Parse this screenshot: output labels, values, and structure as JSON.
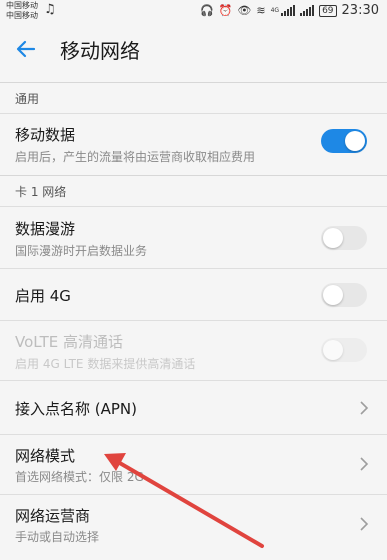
{
  "status_bar": {
    "carrier1": "中国移动",
    "carrier2": "中国移动",
    "network_type": "4G",
    "battery": "69",
    "time": "23:30"
  },
  "header": {
    "title": "移动网络"
  },
  "sections": {
    "general": "通用",
    "sim1": "卡 1 网络"
  },
  "mobile_data": {
    "label": "移动数据",
    "desc": "启用后，产生的流量将由运营商收取相应费用",
    "on": true
  },
  "roaming": {
    "label": "数据漫游",
    "desc": "国际漫游时开启数据业务",
    "on": false
  },
  "enable_4g": {
    "label": "启用 4G",
    "on": false
  },
  "volte": {
    "label": "VoLTE 高清通话",
    "desc": "启用 4G LTE 数据来提供高清通话",
    "on": false
  },
  "apn": {
    "label": "接入点名称 (APN)"
  },
  "network_mode": {
    "label": "网络模式",
    "desc": "首选网络模式：仅限 2G"
  },
  "operator": {
    "label": "网络运营商",
    "desc": "手动或自动选择"
  },
  "colors": {
    "accent": "#1e88e5",
    "annotation_arrow": "#e0443e"
  }
}
